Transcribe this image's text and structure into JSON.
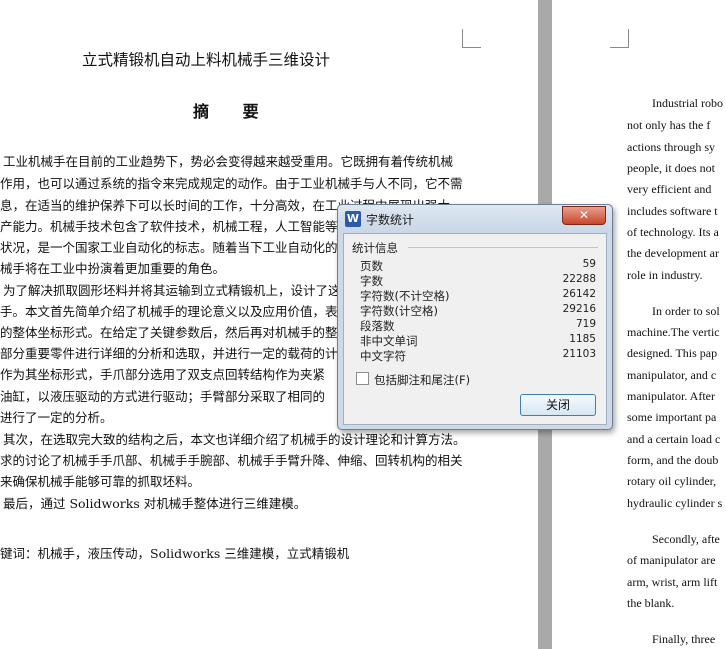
{
  "left_page": {
    "title": "立式精锻机自动上料机械手三维设计",
    "abstract_heading": "摘  要",
    "lines": [
      "工业机械手在目前的工业趋势下，势必会变得越来越受重用。它既拥有着传统机械",
      "作用，也可以通过系统的指令来完成规定的动作。由于工业机械手与人不同，它不需",
      "息，在适当的维护保养下可以长时间的工作，十分高效，在工业过程中展现出强大",
      "产能力。机械手技术包含了软件技术，机械工程，人工智能等多",
      "状况，是一个国家工业自动化的标志。随着当下工业自动化的发",
      "械手将在工业中扮演着更加重要的角色。",
      "为了解决抓取圆形坯料并将其运输到立式精锻机上，设计了这",
      "手。本文首先简单介绍了机械手的理论意义以及应用价值，表达",
      "的整体坐标形式。在给定了关键参数后，然后再对机械手的整体",
      "部分重要零件进行详细的分析和选取，并进行一定的载荷的计算",
      "作为其坐标形式，手爪部分选用了双支点回转结构作为夹紧",
      "油缸，以液压驱动的方式进行驱动；手臂部分采取了相同的",
      "进行了一定的分析。",
      "其次，在选取完大致的结构之后，本文也详细介绍了机械手的设计理论和计算方法。",
      "求的讨论了机械手手爪部、机械手手腕部、机械手手臂升降、伸缩、回转机构的相关",
      "来确保机械手能够可靠的抓取坯料。",
      "最后，通过 Solidworks 对机械手整体进行三维建模。",
      "键词：机械手，液压传动，Solidworks 三维建模，立式精锻机"
    ]
  },
  "right_page": {
    "lines": [
      "Industrial robo",
      "not only has the f",
      "actions through sy",
      "people, it does not",
      "very efficient and",
      "includes software t",
      "of technology. Its a",
      "the development ar",
      "role in industry.",
      "In order to sol",
      "machine.The vertic",
      "designed. This pap",
      "manipulator, and c",
      "manipulator. After",
      "some important pa",
      "and a certain load c",
      "form, and the doub",
      "rotary oil cylinder,",
      "hydraulic cylinder s",
      "Secondly, afte",
      "of manipulator are",
      "arm, wrist, arm lift",
      "the blank.",
      "Finally, three"
    ]
  },
  "dialog": {
    "title": "字数统计",
    "app_icon": "W",
    "close_label": "✕",
    "group_label": "统计信息",
    "stats": [
      {
        "label": "页数",
        "value": "59"
      },
      {
        "label": "字数",
        "value": "22288"
      },
      {
        "label": "字符数(不计空格)",
        "value": "26142"
      },
      {
        "label": "字符数(计空格)",
        "value": "29216"
      },
      {
        "label": "段落数",
        "value": "719"
      },
      {
        "label": "非中文单词",
        "value": "1185"
      },
      {
        "label": "中文字符",
        "value": "21103"
      }
    ],
    "checkbox_label": "包括脚注和尾注(F)",
    "checkbox_checked": false,
    "ok_label": "关闭"
  }
}
